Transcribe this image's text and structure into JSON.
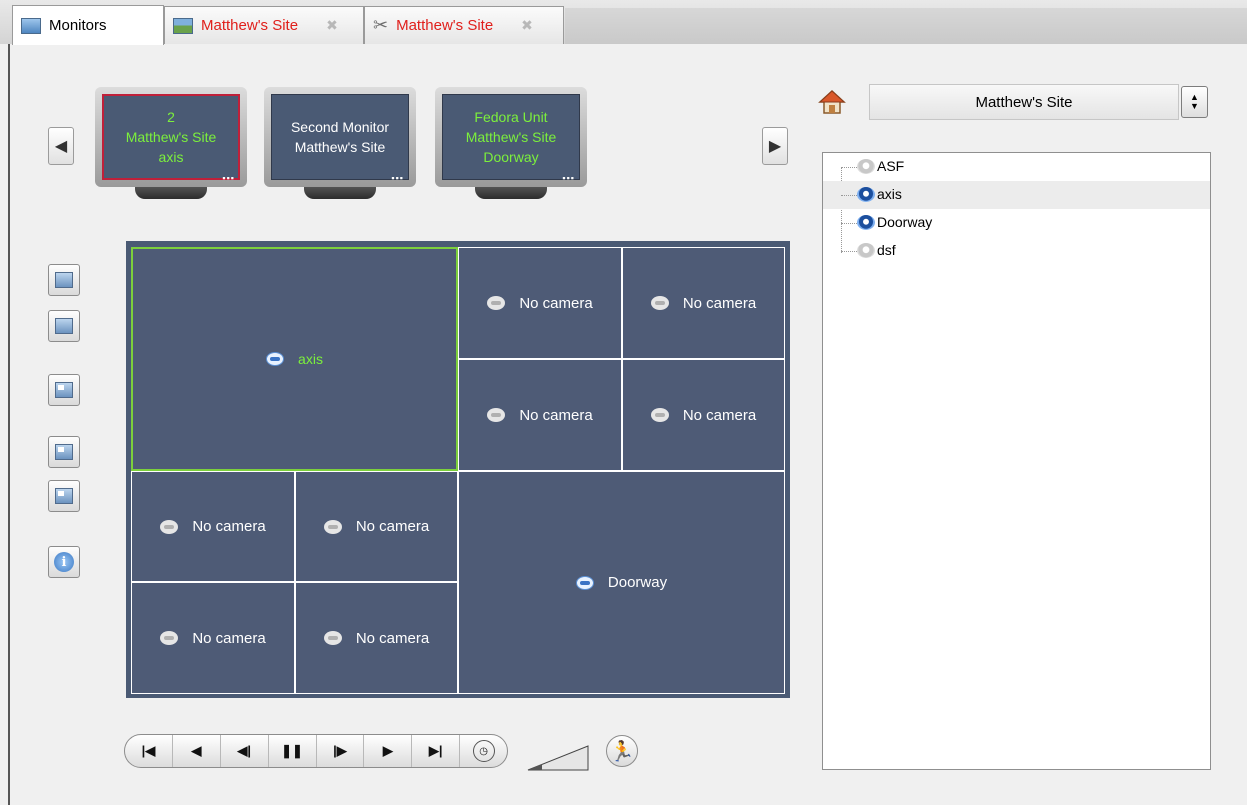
{
  "tabs": [
    {
      "label": "Monitors",
      "style": "active"
    },
    {
      "label": "Matthew's Site",
      "style": "red",
      "icon": "view-icon",
      "close": "✖"
    },
    {
      "label": "Matthew's Site",
      "style": "red",
      "icon": "tools-icon",
      "close": "✖"
    }
  ],
  "monitors": [
    {
      "line1": "2",
      "line2": "Matthew's Site",
      "line3": "axis",
      "state": "selected"
    },
    {
      "line1": "Second Monitor",
      "line2": "Matthew's Site",
      "line3": "",
      "state": "normal"
    },
    {
      "line1": "Fedora Unit",
      "line2": "Matthew's Site",
      "line3": "Doorway",
      "state": "green"
    }
  ],
  "monitor_dots": "▪▪▪",
  "grid": {
    "main_cell": "axis",
    "doorway_cell": "Doorway",
    "empty_label": "No camera"
  },
  "site_selector": {
    "value": "Matthew's Site"
  },
  "tree": {
    "items": [
      {
        "label": "ASF",
        "icon": "camera-offline-icon"
      },
      {
        "label": "axis",
        "icon": "camera-warning-icon",
        "selected": true
      },
      {
        "label": "Doorway",
        "icon": "camera-online-icon"
      },
      {
        "label": "dsf",
        "icon": "camera-offline-icon"
      }
    ]
  },
  "colors": {
    "accent_green": "#7cf03c",
    "tab_red": "#e0201c",
    "monitor_bg": "#4a5a74",
    "selected_border": "#c0203a"
  }
}
